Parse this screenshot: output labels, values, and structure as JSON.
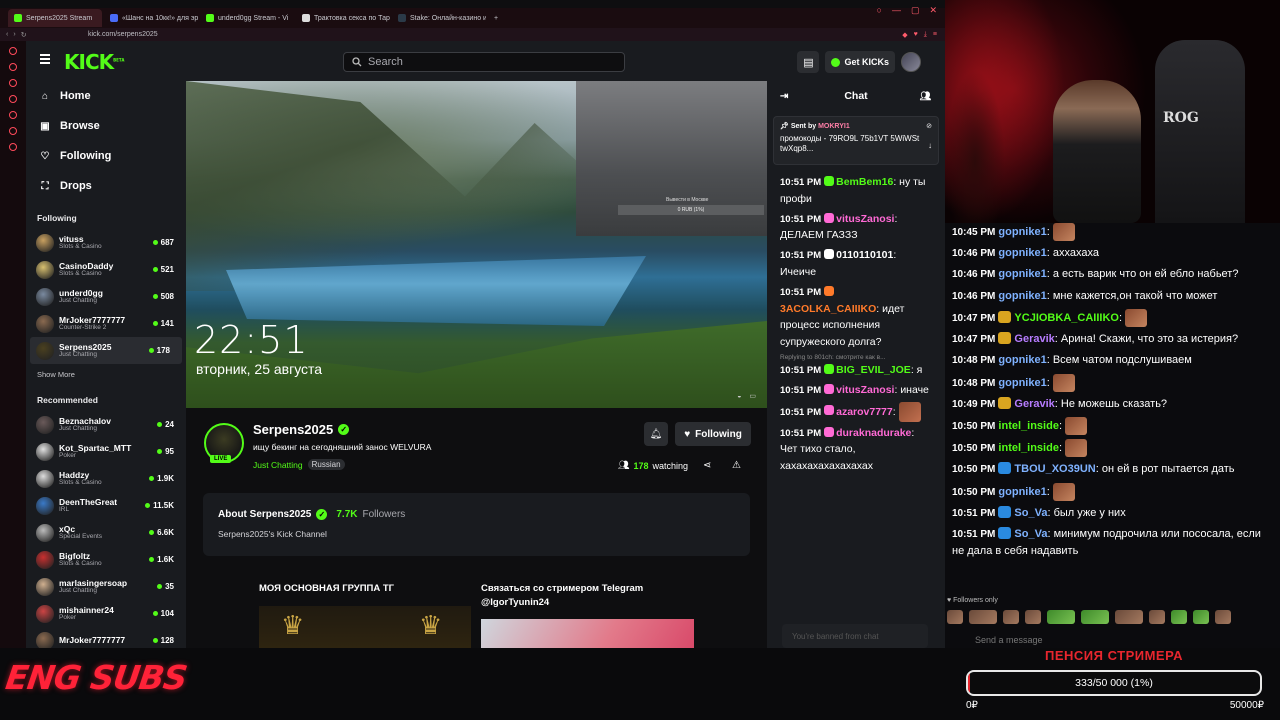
{
  "tabs": [
    {
      "label": "Serpens2025 Stream",
      "fav": "#53fc18",
      "active": true
    },
    {
      "label": "«Шанс на 10кк!» для эри",
      "fav": "#4a6cf7"
    },
    {
      "label": "underd0gg Stream - Vi",
      "fav": "#53fc18"
    },
    {
      "label": "Трактовка секса по Таро",
      "fav": "#dddddd"
    },
    {
      "label": "Stake: Онлайн-казино и с",
      "fav": "#2b3a48"
    }
  ],
  "address": {
    "url": "kick.com/serpens2025"
  },
  "header": {
    "logo": "KICK",
    "logo_sup": "BETA",
    "search_placeholder": "Search",
    "get_kicks_label": "Get KICKs"
  },
  "nav": [
    {
      "label": "Home",
      "icon": "⌂"
    },
    {
      "label": "Browse",
      "icon": "▣"
    },
    {
      "label": "Following",
      "icon": "♡"
    },
    {
      "label": "Drops",
      "icon": "⛶"
    }
  ],
  "following_title": "Following",
  "following": [
    {
      "name": "vituss",
      "category": "Slots & Casino",
      "viewers": "687",
      "color": "#c8a060"
    },
    {
      "name": "CasinoDaddy",
      "category": "Slots & Casino",
      "viewers": "521",
      "color": "#d8c070"
    },
    {
      "name": "underd0gg",
      "category": "Just Chatting",
      "viewers": "508",
      "color": "#7a8aa0"
    },
    {
      "name": "MrJoker7777777",
      "category": "Counter-Strike 2",
      "viewers": "141",
      "color": "#8a6a50"
    },
    {
      "name": "Serpens2025",
      "category": "Just Chatting",
      "viewers": "178",
      "color": "#4a4020",
      "active": true
    }
  ],
  "show_more": "Show More",
  "recommended_title": "Recommended",
  "recommended": [
    {
      "name": "Beznachalov",
      "category": "Just Chatting",
      "viewers": "24",
      "color": "#6a5a5a"
    },
    {
      "name": "Kot_Spartac_MTT",
      "category": "Poker",
      "viewers": "95",
      "color": "#e0e0e0"
    },
    {
      "name": "Haddzy",
      "category": "Slots & Casino",
      "viewers": "1.9K",
      "color": "#dddddd"
    },
    {
      "name": "DeenTheGreat",
      "category": "IRL",
      "viewers": "11.5K",
      "color": "#3a7ac8"
    },
    {
      "name": "xQc",
      "category": "Special Events",
      "viewers": "6.6K",
      "color": "#bbbbbb"
    },
    {
      "name": "Bigfoltz",
      "category": "Slots & Casino",
      "viewers": "1.6K",
      "color": "#c83030"
    },
    {
      "name": "marlasingersoap",
      "category": "Just Chatting",
      "viewers": "35",
      "color": "#d0b090"
    },
    {
      "name": "mishainner24",
      "category": "Poker",
      "viewers": "104",
      "color": "#cc4444"
    },
    {
      "name": "MrJoker7777777",
      "category": "",
      "viewers": "128",
      "color": "#8a6a50"
    }
  ],
  "video": {
    "clock": "22:51",
    "date": "вторник, 25 августа",
    "overlay_text": "Вывести в Москве",
    "overlay_box": "0 RUB (1%)"
  },
  "stream": {
    "live": "LIVE",
    "name": "Serpens2025",
    "title": "ищу бекинг на сегодняшний занос WELVURA",
    "category": "Just Chatting",
    "tag": "Russian",
    "following_label": "Following",
    "watching_count": "178",
    "watching_label": "watching"
  },
  "about": {
    "title": "About Serpens2025",
    "followers_count": "7.7K",
    "followers_label": "Followers",
    "description": "Serpens2025's Kick Channel"
  },
  "panels": [
    {
      "title": "МОЯ ОСНОВНАЯ ГРУППА ТГ"
    },
    {
      "title": "Связаться со стримером Telegram @IgorTyunin24"
    }
  ],
  "chat": {
    "title": "Chat",
    "pinned_by_label": "Sent by",
    "pinned_user": "MOKRYI1",
    "pinned_message": "промокоды - 79RO9L 75b1VT 5WiWSt twXqp8...",
    "reply_hint": "Replying to 801ch: смотрите как в...",
    "messages": [
      {
        "time": "10:51 PM",
        "user": "BemBem16",
        "color": "#53fc18",
        "text": "ну ты профи"
      },
      {
        "time": "10:51 PM",
        "user": "vitusZanosi",
        "color": "#ff6ad5",
        "text": "ДЕЛАЕМ ГАЗЗЗ"
      },
      {
        "time": "10:51 PM",
        "user": "0110110101",
        "color": "#ffffff",
        "text": "Ичеиче"
      },
      {
        "time": "10:51 PM",
        "user": "3ACOLKA_CAIIIKO",
        "color": "#ff7a2a",
        "text": "идет процесс исполнения супружеского долга?"
      },
      {
        "time": "10:51 PM",
        "user": "BIG_EVIL_JOE",
        "color": "#53fc18",
        "text": "я"
      },
      {
        "time": "10:51 PM",
        "user": "vitusZanosi",
        "color": "#ff6ad5",
        "text": "иначе"
      },
      {
        "time": "10:51 PM",
        "user": "azarov7777",
        "color": "#ff6ad5",
        "text": ""
      },
      {
        "time": "10:51 PM",
        "user": "duraknadurake",
        "color": "#ff6ad5",
        "text": "Чет тихо стало, хахахахахахахахах"
      }
    ],
    "input_placeholder": "You're banned from chat"
  },
  "overlay_chat": {
    "messages": [
      {
        "time": "10:45 PM",
        "user": "gopnike1",
        "color": "#7fb2ff",
        "text": "",
        "emote": true
      },
      {
        "time": "10:46 PM",
        "user": "gopnike1",
        "color": "#7fb2ff",
        "text": "аххахаха"
      },
      {
        "time": "10:46 PM",
        "user": "gopnike1",
        "color": "#7fb2ff",
        "text": "а есть варик что он ей ебло набьет?"
      },
      {
        "time": "10:46 PM",
        "user": "gopnike1",
        "color": "#7fb2ff",
        "text": "мне кажется,он такой что может"
      },
      {
        "time": "10:47 PM",
        "user": "YCJIOBKA_CAIIIKO",
        "color": "#53fc18",
        "text": "",
        "emote": true,
        "badge": "#d9a520"
      },
      {
        "time": "10:47 PM",
        "user": "Geravik",
        "color": "#b77cff",
        "text": "Арина! Скажи, что это за истерия?",
        "badge": "#d9a520"
      },
      {
        "time": "10:48 PM",
        "user": "gopnike1",
        "color": "#7fb2ff",
        "text": "Всем чатом подслушиваем"
      },
      {
        "time": "10:48 PM",
        "user": "gopnike1",
        "color": "#7fb2ff",
        "text": "",
        "emote": true
      },
      {
        "time": "10:49 PM",
        "user": "Geravik",
        "color": "#b77cff",
        "text": "Не можешь сказать?",
        "badge": "#d9a520"
      },
      {
        "time": "10:50 PM",
        "user": "intel_inside",
        "color": "#53fc18",
        "text": "",
        "emote": true
      },
      {
        "time": "10:50 PM",
        "user": "intel_inside",
        "color": "#53fc18",
        "text": "",
        "emote": true
      },
      {
        "time": "10:50 PM",
        "user": "TBOU_XO39UN",
        "color": "#7fb2ff",
        "text": "он ей в рот пытается дать",
        "badge": "#2a8ae0"
      },
      {
        "time": "10:50 PM",
        "user": "gopnike1",
        "color": "#7fb2ff",
        "text": "",
        "emote": true
      },
      {
        "time": "10:51 PM",
        "user": "So_Va",
        "color": "#7fb2ff",
        "text": "был уже у них",
        "badge": "#2a8ae0"
      },
      {
        "time": "10:51 PM",
        "user": "So_Va",
        "color": "#7fb2ff",
        "text": "минимум подрочила или пососала, если не дала в себя надавить",
        "badge": "#2a8ae0",
        "wrap": true
      }
    ],
    "followers_only": "Followers only",
    "input_placeholder": "Send a message"
  },
  "eng_subs": "ENG SUBS",
  "goal": {
    "title": "ПЕНСИЯ СТРИМЕРА",
    "progress_text": "333/50 000 (1%)",
    "progress_fraction": 0.0067,
    "min": "0₽",
    "max": "50000₽"
  }
}
